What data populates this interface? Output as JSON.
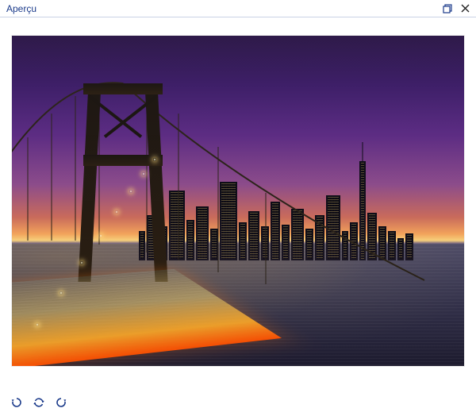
{
  "panel": {
    "title": "Aperçu"
  },
  "icons": {
    "restore": "restore-icon",
    "close": "close-icon",
    "rotate_ccw": "rotate-ccw-icon",
    "refresh": "refresh-icon",
    "rotate_cw": "rotate-cw-icon"
  }
}
